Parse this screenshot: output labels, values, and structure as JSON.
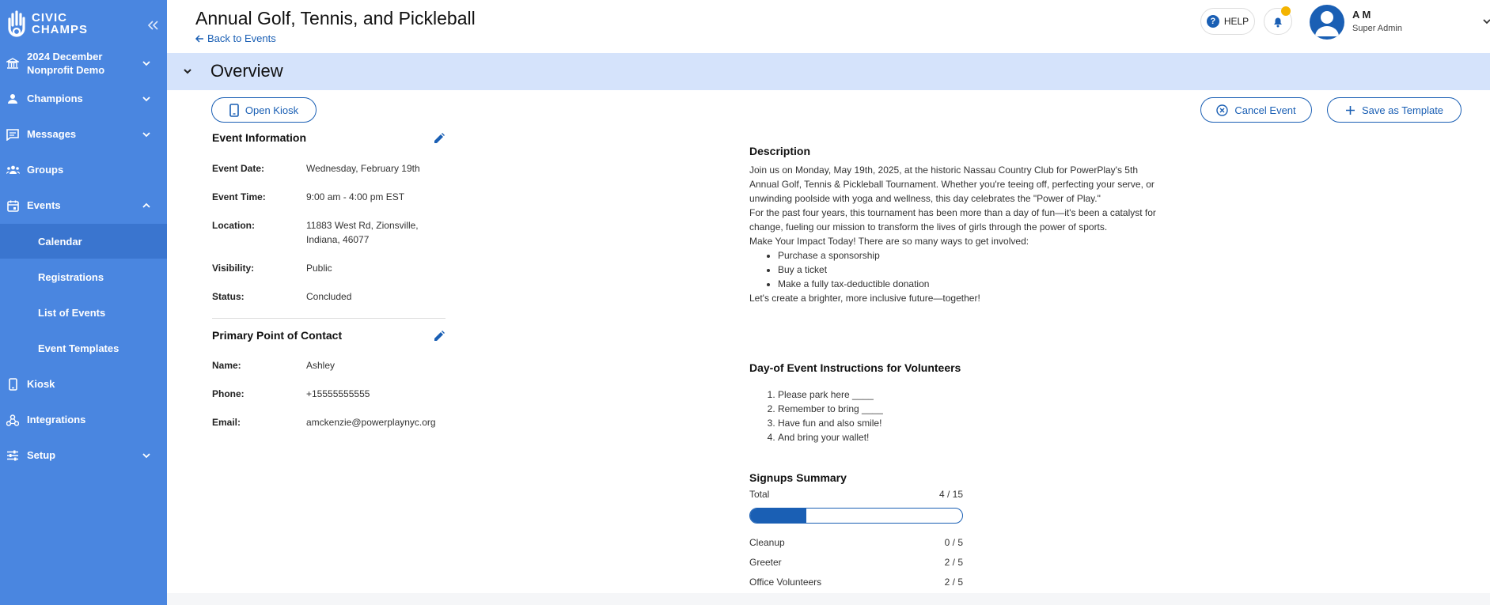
{
  "sidebar": {
    "logo_line1": "CIVIC",
    "logo_line2": "CHAMPS",
    "org_line1": "2024 December",
    "org_line2": "Nonprofit Demo",
    "items": {
      "champions": "Champions",
      "messages": "Messages",
      "groups": "Groups",
      "events": "Events",
      "kiosk": "Kiosk",
      "integrations": "Integrations",
      "setup": "Setup"
    },
    "events_sub": {
      "calendar": "Calendar",
      "registrations": "Registrations",
      "list_of_events": "List of Events",
      "event_templates": "Event Templates"
    }
  },
  "header": {
    "title": "Annual Golf, Tennis, and Pickleball",
    "back_link": "Back to Events",
    "help": "HELP",
    "user_name": "A M",
    "user_role": "Super Admin"
  },
  "section": {
    "title": "Overview"
  },
  "buttons": {
    "open_kiosk": "Open Kiosk",
    "cancel_event": "Cancel Event",
    "save_template": "Save as Template"
  },
  "event_info": {
    "title": "Event Information",
    "date_label": "Event Date:",
    "date": "Wednesday, February 19th",
    "time_label": "Event Time:",
    "time": "9:00 am - 4:00 pm EST",
    "location_label": "Location:",
    "location": "11883 West Rd, Zionsville, Indiana, 46077",
    "visibility_label": "Visibility:",
    "visibility": "Public",
    "status_label": "Status:",
    "status": "Concluded"
  },
  "contact": {
    "title": "Primary Point of Contact",
    "name_label": "Name:",
    "name": "Ashley",
    "phone_label": "Phone:",
    "phone": "+15555555555",
    "email_label": "Email:",
    "email": "amckenzie@powerplaynyc.org"
  },
  "description": {
    "title": "Description",
    "para1": "Join us on Monday, May 19th, 2025, at the historic Nassau Country Club for PowerPlay's 5th Annual Golf, Tennis & Pickleball Tournament. Whether you're teeing off, perfecting your serve, or unwinding poolside with yoga and wellness, this day celebrates the \"Power of Play.\"",
    "para2": "For the past four years, this tournament has been more than a day of fun—it's been a catalyst for change, fueling our mission to transform the lives of girls through the power of sports.",
    "para3": "Make Your Impact Today! There are so many ways to get involved:",
    "bullets": [
      "Purchase a sponsorship",
      "Buy a ticket",
      "Make a fully tax-deductible donation"
    ],
    "closing": "Let's create a brighter, more inclusive future—together!"
  },
  "instructions": {
    "title": "Day-of Event Instructions for Volunteers",
    "items": [
      "Please park here ____",
      "Remember to bring ____",
      "Have fun and also smile!",
      "And bring your wallet!"
    ]
  },
  "signups": {
    "title": "Signups Summary",
    "total_label": "Total",
    "total": "4 / 15",
    "progress_fraction": 0.2667,
    "roles": [
      {
        "name": "Cleanup",
        "count": "0 / 5"
      },
      {
        "name": "Greeter",
        "count": "2 / 5"
      },
      {
        "name": "Office Volunteers",
        "count": "2 / 5"
      }
    ]
  },
  "colors": {
    "sidebar": "#4a86e0",
    "accent": "#1a5fb4",
    "section_bar": "#d5e3fb",
    "notification_dot": "#f4b400"
  }
}
